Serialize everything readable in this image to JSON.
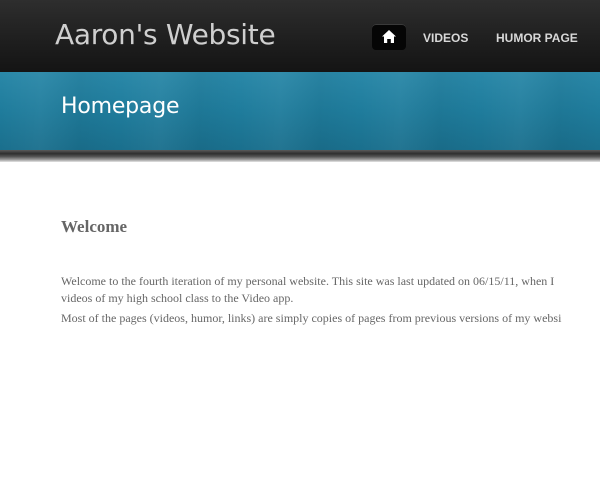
{
  "header": {
    "site_title": "Aaron's Website",
    "nav": {
      "home_icon": "home-icon",
      "videos_label": "VIDEOS",
      "humor_label": "HUMOR PAGE"
    }
  },
  "banner": {
    "page_title": "Homepage"
  },
  "main": {
    "heading": "Welcome",
    "paragraph_1_line_1": "Welcome to the fourth iteration of my personal website.  This site was last updated on 06/15/11, when I",
    "paragraph_1_line_2": "videos of my high school class to the Video app.",
    "paragraph_2": "Most of the pages (videos, humor, links) are simply copies of pages from previous versions of my websi"
  },
  "colors": {
    "header_bg": "#1f1f1f",
    "banner_bg": "#1f7c9c",
    "text": "#666666"
  }
}
